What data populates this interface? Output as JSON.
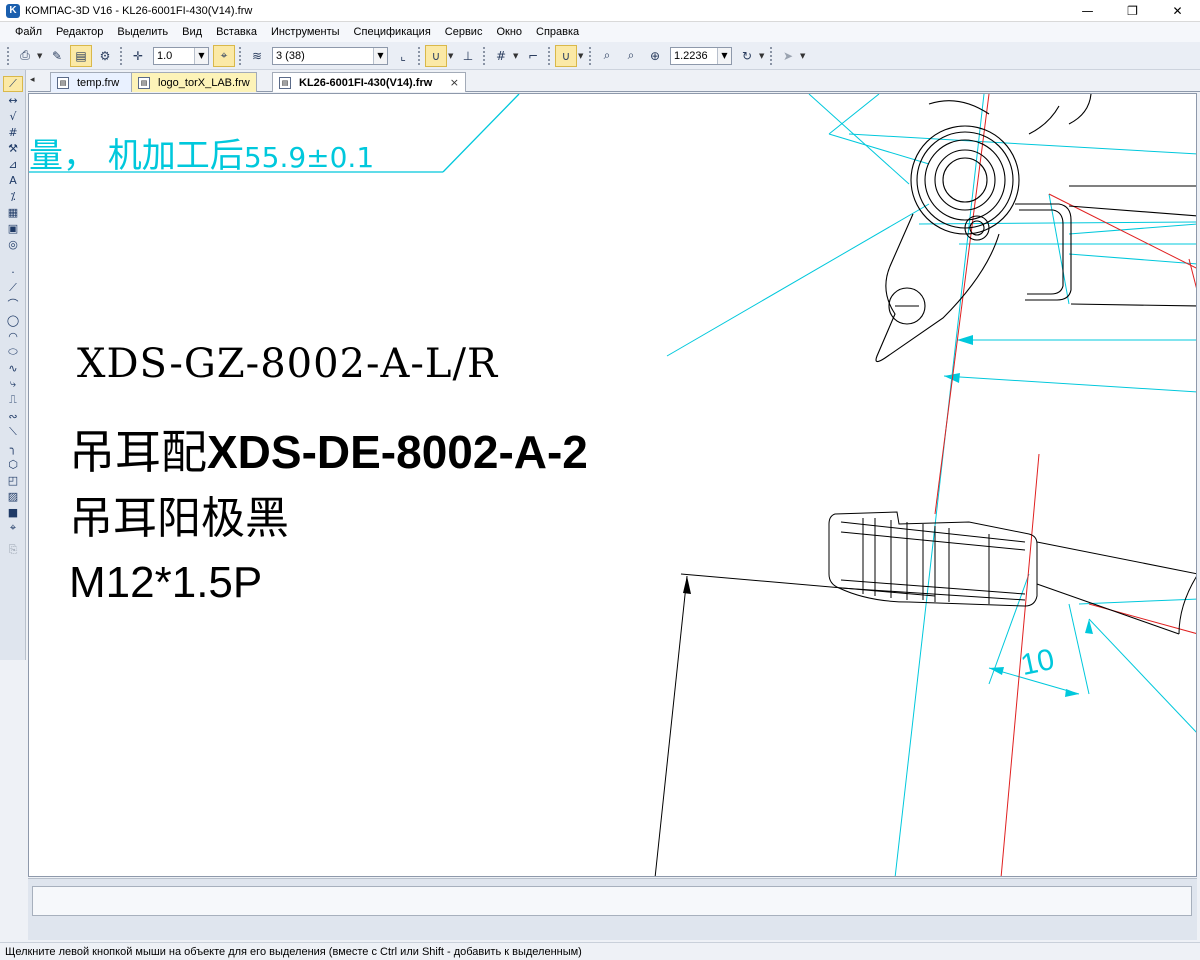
{
  "window": {
    "title": "КОМПАС-3D V16  - KL26-6001FI-430(V14).frw",
    "minimize": "—",
    "restore": "❐",
    "close": "✕"
  },
  "menu": [
    "Файл",
    "Редактор",
    "Выделить",
    "Вид",
    "Вставка",
    "Инструменты",
    "Спецификация",
    "Сервис",
    "Окно",
    "Справка"
  ],
  "toolbar": {
    "step_value": "1.0",
    "layer_value": "3 (38)",
    "zoom_value": "1.2236"
  },
  "tabs": [
    {
      "label": "temp.frw"
    },
    {
      "label": "logo_torX_LAB.frw"
    },
    {
      "label": "KL26-6001FI-430(V14).frw",
      "close": "×"
    }
  ],
  "drawing": {
    "note_cyan": "量，  机加工后",
    "note_cyan_value": "55.9±0.1",
    "part_number": "XDS-GZ-8002-A-L/R",
    "mating_prefix": "吊耳配",
    "mating_part": "XDS-DE-8002-A-2",
    "anodize": "吊耳阳极黑",
    "thread": "M12*1.5P",
    "dim_10": "10"
  },
  "status": {
    "hint": "Щелкните левой кнопкой мыши на объекте для его выделения (вместе с Ctrl или Shift - добавить к выделенным)"
  },
  "colors": {
    "cyan": "#00c8dc",
    "red": "#e02020",
    "accent": "#fbe9a6"
  }
}
